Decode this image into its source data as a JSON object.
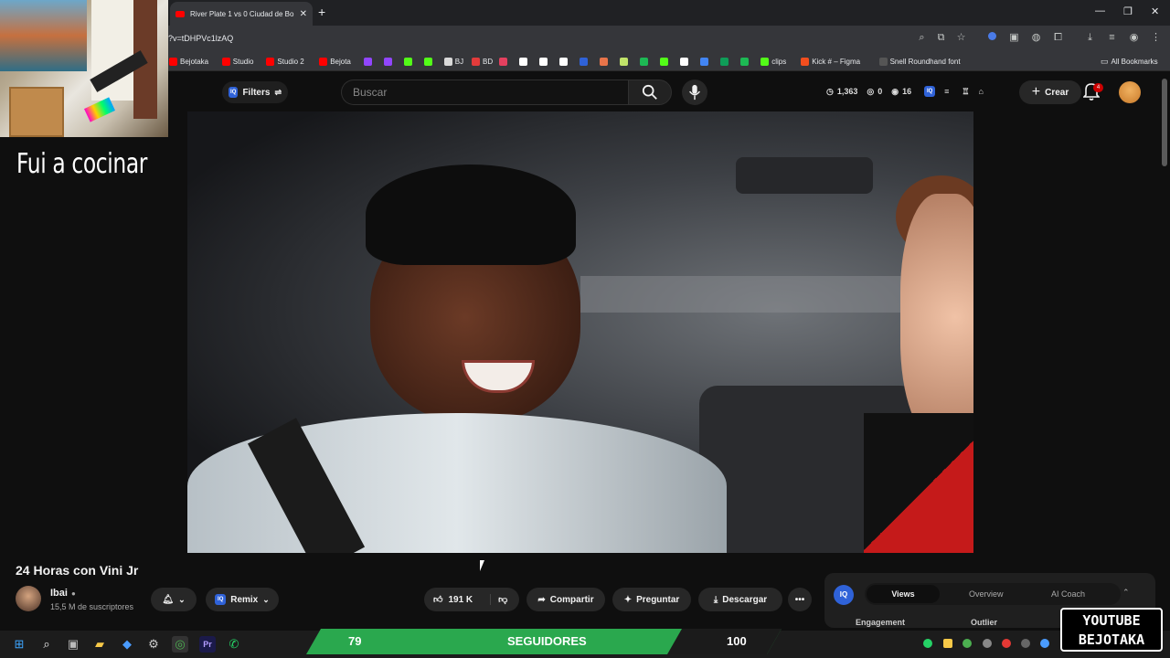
{
  "browser": {
    "tab_title": "River Plate 1 vs 0 Ciudad de Bo",
    "url": "?v=tDHPVc1lzAQ",
    "all_bookmarks": "All Bookmarks",
    "bookmarks": [
      {
        "label": "Bejotaka",
        "color": "#ff0000"
      },
      {
        "label": "Studio",
        "color": "#ff0000"
      },
      {
        "label": "Studio 2",
        "color": "#ff0000"
      },
      {
        "label": "Bejota",
        "color": "#ff0000"
      },
      {
        "label": "",
        "color": "#9146ff"
      },
      {
        "label": "",
        "color": "#9146ff"
      },
      {
        "label": "",
        "color": "#53fc18"
      },
      {
        "label": "",
        "color": "#53fc18"
      },
      {
        "label": "BJ",
        "color": "#d9d9d9"
      },
      {
        "label": "BD",
        "color": "#e23b3b"
      },
      {
        "label": "",
        "color": "#e4405f"
      },
      {
        "label": "",
        "color": "#ffffff"
      },
      {
        "label": "",
        "color": "#ffffff"
      },
      {
        "label": "",
        "color": "#ffffff"
      },
      {
        "label": "",
        "color": "#2f62d8"
      },
      {
        "label": "",
        "color": "#e8744a"
      },
      {
        "label": "",
        "color": "#c1e36a"
      },
      {
        "label": "",
        "color": "#1db954"
      },
      {
        "label": "",
        "color": "#53fc18"
      },
      {
        "label": "",
        "color": "#ffffff"
      },
      {
        "label": "",
        "color": "#4285f4"
      },
      {
        "label": "",
        "color": "#0f9d58"
      },
      {
        "label": "",
        "color": "#1db954"
      },
      {
        "label": "clips",
        "color": "#53fc18"
      },
      {
        "label": "Kick # – Figma",
        "color": "#f24e1e"
      },
      {
        "label": "Snell Roundhand font",
        "color": "#555555"
      }
    ]
  },
  "overlay": {
    "caption": "Fui a cocinar",
    "followers_current": "79",
    "followers_label": "SEGUIDORES",
    "followers_goal": "100",
    "followers_progress": 0.79,
    "watermark_line1": "YOUTUBE",
    "watermark_line2": "BEJOTAKA"
  },
  "header": {
    "filters_label": "Filters",
    "search_placeholder": "Buscar",
    "stat_views": "1,363",
    "stat_a": "0",
    "stat_b": "16",
    "create_label": "Crear",
    "notifications": "4"
  },
  "video": {
    "title": "24 Horas con Vini Jr",
    "channel": "Ibai",
    "subscribers": "15,5 M de suscriptores",
    "remix_label": "Remix",
    "likes": "191 K",
    "share_label": "Compartir",
    "ask_label": "Preguntar",
    "download_label": "Descargar"
  },
  "panel": {
    "tabs": [
      "Views",
      "Overview",
      "AI Coach"
    ],
    "engagement_label": "Engagement",
    "outlier_label": "Outlier",
    "badge": "IQ"
  },
  "colors": {
    "youtube_red": "#ff0000",
    "follow_bar_green": "#2aa84e",
    "vidiq_blue": "#2f62d8"
  }
}
